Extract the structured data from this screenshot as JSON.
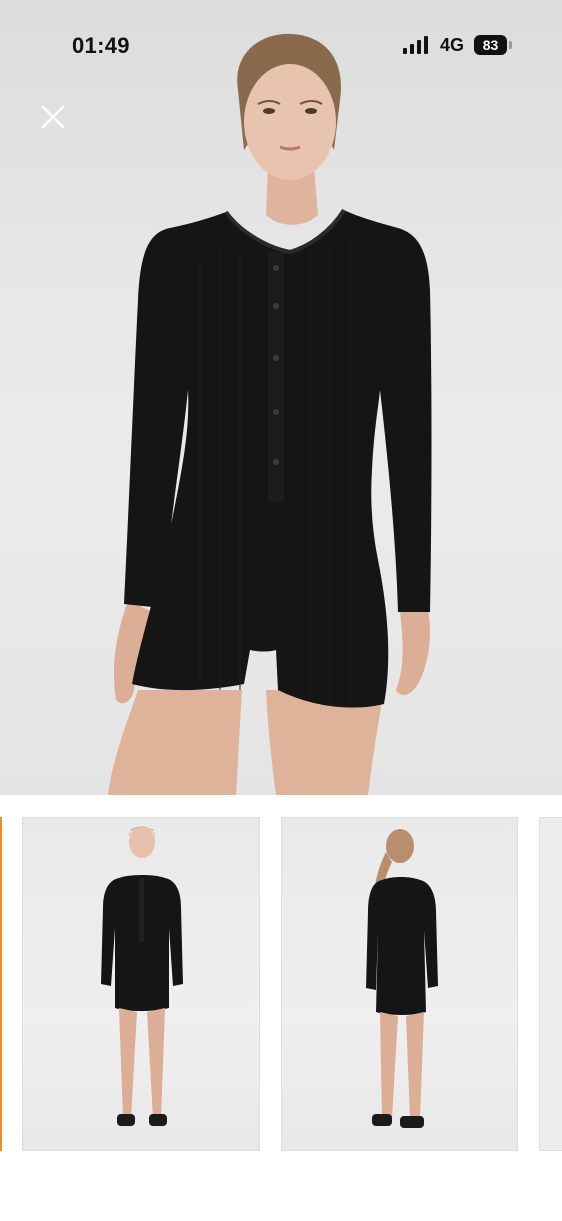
{
  "status_bar": {
    "time": "01:49",
    "network": "4G",
    "battery_level": "83",
    "signal_icon": "cellular-signal-icon"
  },
  "hero": {
    "image_desc_icon": "product-photo",
    "close_icon": "close-icon"
  },
  "thumbnails": {
    "items": [
      {
        "view": "front",
        "selected": false
      },
      {
        "view": "back",
        "selected": false
      }
    ],
    "active_indicator_color": "#f08a2c"
  },
  "colors": {
    "garment": "#141414",
    "background": "#e6e6e6",
    "skin": "#e2b9a2"
  }
}
